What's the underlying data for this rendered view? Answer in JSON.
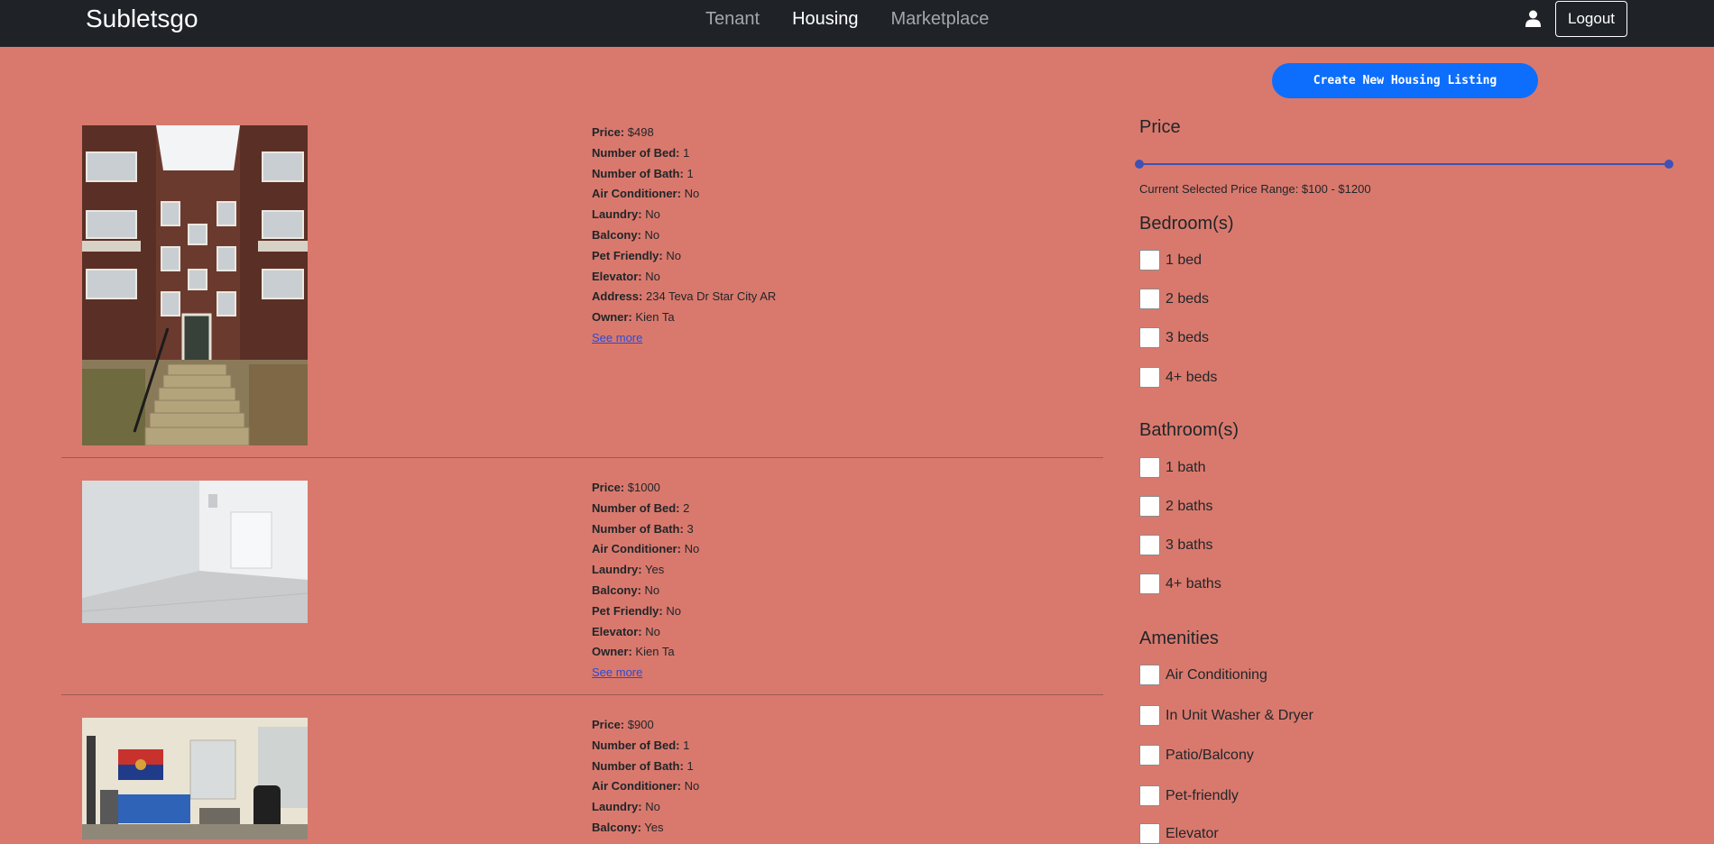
{
  "navbar": {
    "brand": "Subletsgo",
    "links": [
      "Tenant",
      "Housing",
      "Marketplace"
    ],
    "active": "Housing",
    "logout": "Logout"
  },
  "create_button": "Create New Housing Listing",
  "listings": [
    {
      "rows": [
        {
          "k": "Price:",
          "v": "$498"
        },
        {
          "k": "Number of Bed:",
          "v": "1"
        },
        {
          "k": "Number of Bath:",
          "v": "1"
        },
        {
          "k": "Air Conditioner:",
          "v": "No"
        },
        {
          "k": "Laundry:",
          "v": "No"
        },
        {
          "k": "Balcony:",
          "v": "No"
        },
        {
          "k": "Pet Friendly:",
          "v": "No"
        },
        {
          "k": "Elevator:",
          "v": "No"
        },
        {
          "k": "Address:",
          "v": "234 Teva Dr Star City AR"
        },
        {
          "k": "Owner:",
          "v": "Kien Ta"
        }
      ],
      "see_more": "See more"
    },
    {
      "rows": [
        {
          "k": "Price:",
          "v": "$1000"
        },
        {
          "k": "Number of Bed:",
          "v": "2"
        },
        {
          "k": "Number of Bath:",
          "v": "3"
        },
        {
          "k": "Air Conditioner:",
          "v": "No"
        },
        {
          "k": "Laundry:",
          "v": "Yes"
        },
        {
          "k": "Balcony:",
          "v": "No"
        },
        {
          "k": "Pet Friendly:",
          "v": "No"
        },
        {
          "k": "Elevator:",
          "v": "No"
        },
        {
          "k": "Owner:",
          "v": "Kien Ta"
        }
      ],
      "see_more": "See more"
    },
    {
      "rows": [
        {
          "k": "Price:",
          "v": "$900"
        },
        {
          "k": "Number of Bed:",
          "v": "1"
        },
        {
          "k": "Number of Bath:",
          "v": "1"
        },
        {
          "k": "Air Conditioner:",
          "v": "No"
        },
        {
          "k": "Laundry:",
          "v": "No"
        },
        {
          "k": "Balcony:",
          "v": "Yes"
        }
      ],
      "see_more": ""
    }
  ],
  "filters": {
    "price": {
      "title": "Price",
      "range_text": "Current Selected Price Range: $100 - $1200",
      "min": 100,
      "max": 1200
    },
    "bedrooms": {
      "title": "Bedroom(s)",
      "options": [
        "1 bed",
        "2 beds",
        "3 beds",
        "4+ beds"
      ]
    },
    "bathrooms": {
      "title": "Bathroom(s)",
      "options": [
        "1 bath",
        "2 baths",
        "3 baths",
        "4+ baths"
      ]
    },
    "amenities": {
      "title": "Amenities",
      "options": [
        "Air Conditioning",
        "In Unit Washer & Dryer",
        "Patio/Balcony",
        "Pet-friendly",
        "Elevator"
      ]
    }
  },
  "colors": {
    "background": "#d9796d",
    "navbar": "#1f2328",
    "primary_button": "#0d6efd",
    "slider": "#3f51b5"
  }
}
